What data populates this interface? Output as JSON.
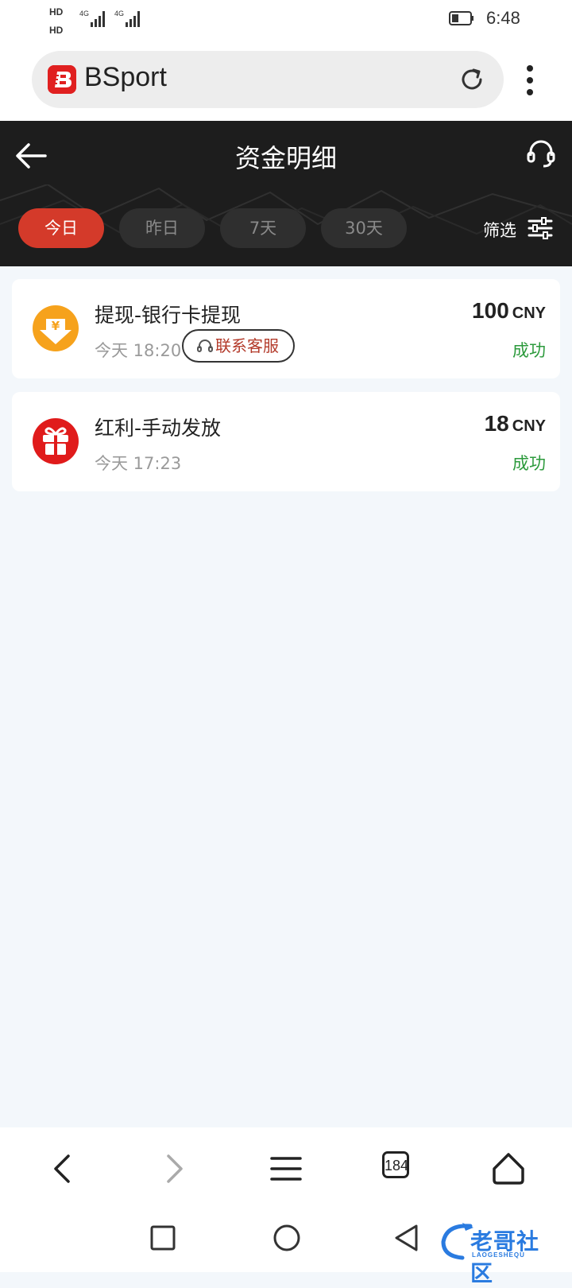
{
  "status_bar": {
    "time": "6:48",
    "sim1_label": "HD",
    "sim2_label": "HD",
    "network1": "4G",
    "network2": "4G"
  },
  "browser": {
    "site_name": "BSport",
    "tab_count": "184"
  },
  "header": {
    "title": "资金明细",
    "tabs": [
      {
        "label": "今日",
        "active": true
      },
      {
        "label": "昨日",
        "active": false
      },
      {
        "label": "7天",
        "active": false
      },
      {
        "label": "30天",
        "active": false
      }
    ],
    "filter_label": "筛选"
  },
  "records": [
    {
      "title": "提现-银行卡提现",
      "time": "今天 18:20",
      "contact_label": "联系客服",
      "amount": "100",
      "currency": "CNY",
      "status": "成功",
      "icon": "withdraw-yuan-icon"
    },
    {
      "title": "红利-手动发放",
      "time": "今天 17:23",
      "amount": "18",
      "currency": "CNY",
      "status": "成功",
      "icon": "gift-icon"
    }
  ],
  "watermark": {
    "text": "老哥社区",
    "sub": "LAOGESHEQU"
  },
  "colors": {
    "accent_red": "#d43a2a",
    "success_green": "#2c9a3c",
    "header_bg": "#1d1d1d",
    "page_bg": "#f3f7fb"
  }
}
